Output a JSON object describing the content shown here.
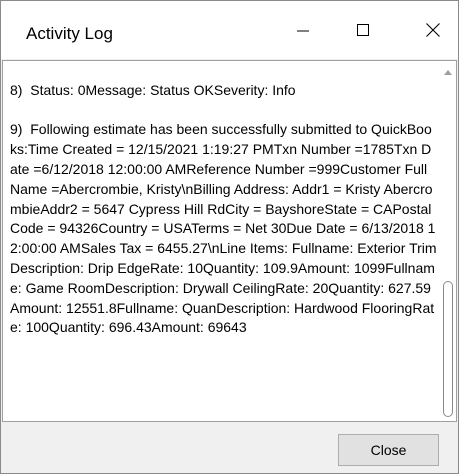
{
  "window": {
    "title": "Activity Log"
  },
  "titlebar": {
    "minimize_icon": "minimize-icon",
    "maximize_icon": "maximize-icon",
    "close_icon": "close-icon"
  },
  "log": {
    "text": "\n8)  Status: 0Message: Status OKSeverity: Info\n\n9)  Following estimate has been successfully submitted to QuickBooks:Time Created = 12/15/2021 1:19:27 PMTxn Number =1785Txn Date =6/12/2018 12:00:00 AMReference Number =999Customer FullName =Abercrombie, Kristy\\nBilling Address: Addr1 = Kristy AbercrombieAddr2 = 5647 Cypress Hill RdCity = BayshoreState = CAPostal Code = 94326Country = USATerms = Net 30Due Date = 6/13/2018 12:00:00 AMSales Tax = 6455.27\\nLine Items: Fullname: Exterior TrimDescription: Drip EdgeRate: 10Quantity: 109.9Amount: 1099Fullname: Game RoomDescription: Drywall CeilingRate: 20Quantity: 627.59Amount: 12551.8Fullname: QuanDescription: Hardwood FlooringRate: 100Quantity: 696.43Amount: 69643"
  },
  "footer": {
    "close_label": "Close"
  },
  "colors": {
    "window_bg": "#f0f0f0",
    "content_bg": "#ffffff",
    "button_bg": "#e1e1e1",
    "button_border": "#adadad"
  }
}
